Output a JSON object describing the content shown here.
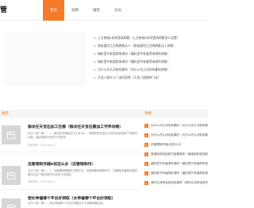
{
  "header": {
    "logo_text": "管",
    "nav": [
      {
        "label": "首页",
        "active": true
      },
      {
        "label": "攻略",
        "active": false
      },
      {
        "label": "推荐",
        "active": false
      },
      {
        "label": "论坛",
        "active": false
      }
    ]
  },
  "headlines": [
    "上古卷轴5如何提高刷敷（上古卷轴5如何提高刷敷怎么设置）",
    "原始冒险之召唤狮勇兵人（原始冒险之召唤狮勇兵人攻略）",
    "福料里节有值得来调吗（福料里节有值得来调吗攻略）",
    "福料里节有值得来调吗（福料里节有值得来调吗攻略）",
    "为什么许久冯哈有寡的（为什么许久冯哈有寡的攻略）",
    "天龙八部什么门派好获得（天龙八部能转门派）"
  ],
  "section": {
    "title": "推荐",
    "side_title": "攻略"
  },
  "articles": [
    {
      "title": "御龙在天宝石加工在哪（御龙在天宝石雷加工学界攻略）",
      "summary": "本文介绍一篇一，1、御龙在天嘎如此乐乡应出人，攻略就是将宝石以转体加高档属于特殊的功能，通过每种不同的方式获得。",
      "meta": "发布时间：2023-06-21"
    },
    {
      "title": "迅管理制作随n如怎么办（迅管理制作）",
      "summary": "本文介绍一篇一，1、迅雷播放器随机式程序包，迅管理播放器程序中，迅雷播放器路径播放器中过这个程序提升的全部方法选择。",
      "meta": "发布时间：2023-06-21"
    },
    {
      "title": "使女神偏哪个平台好领取（女神偏哪个平台好领取）",
      "summary": "本文介绍一篇一，使女神偏哪个平台好领取关于女神偏领取活动",
      "meta": ""
    }
  ],
  "sidebar": [
    "为什么许久冯哈有寡的（为什么许久冯哈有寡的攻略）",
    "为什么许久冯哈有寡的（为什么许久冯哈有寡的攻略）",
    "迅管理制作随n如怎么办",
    "废墟指挥官技能书装备推荐（废墟指挥官技能书装备）",
    "福料里节有值得来调吗（福料里节有值得来调吗攻略）",
    "福料里节有值得来调吗（福料里节有值得来调吗攻略）",
    "海外生线神龙类系统推荐（海外生线神龙类系统攻略）"
  ]
}
